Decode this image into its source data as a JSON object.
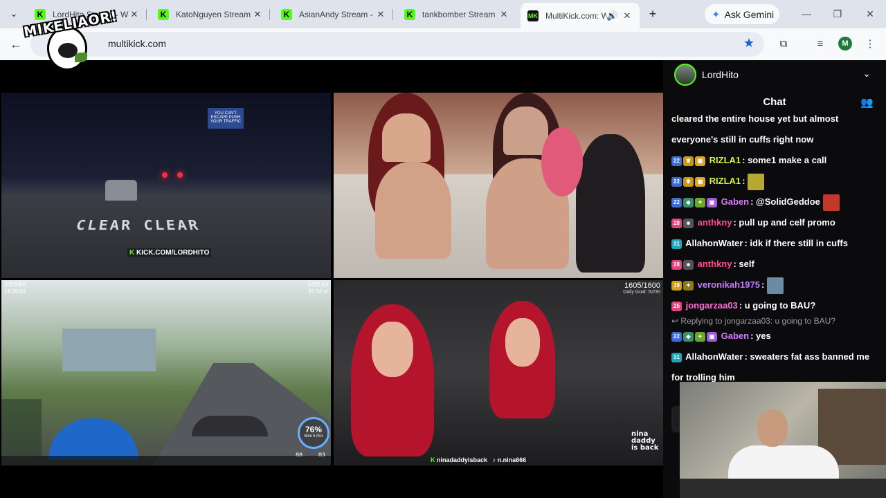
{
  "tabs": [
    {
      "title": "LordHito Stream - W",
      "favicon": "kick-icon",
      "active": false
    },
    {
      "title": "KatoNguyen Stream",
      "favicon": "kick-icon",
      "active": false
    },
    {
      "title": "AsianAndy Stream -",
      "favicon": "kick-icon",
      "active": false
    },
    {
      "title": "tankbomber Stream",
      "favicon": "kick-icon",
      "active": false
    },
    {
      "title": "MultiKick.com: W",
      "favicon": "multikick-icon",
      "active": true
    }
  ],
  "new_tab_label": "+",
  "gemini_label": "Ask Gemini",
  "address": {
    "url": "multikick.com"
  },
  "profile_initial": "M",
  "watermark": {
    "text": "MIKELIAOR!"
  },
  "streams": {
    "s1": {
      "road_text": "CLEAR CLEAR",
      "tag": "KICK.COM/LORDHITO",
      "billboard": "YOU CAN'T ESCAPE PUSH YOUR TRAFFIC"
    },
    "s3": {
      "date": "2026/8/6",
      "time": "19:30:02",
      "speed_top": "5425 kB",
      "speed_bottom": "37.34 m",
      "battery": "76%",
      "battery_sub": "Mini 5 Pro",
      "stat_a": "88",
      "stat_b": "83"
    },
    "s4": {
      "goal": "1605/1600",
      "goal_sub": "Daily Goal: 52/30",
      "handle_kick": "ninadaddyisback",
      "handle_tiktok": "n.nina666",
      "brand": "nina daddy is back"
    }
  },
  "chat": {
    "streamer": "LordHito",
    "title": "Chat",
    "messages": [
      {
        "user": "",
        "text": "cleared the entire house yet but almost",
        "badges": []
      },
      {
        "user": "",
        "text": "everyone's still in cuffs right now",
        "badges": []
      },
      {
        "user": "RIZLA1",
        "user_color": "#d4f53a",
        "text": "some1 make a call",
        "badges": [
          "22",
          "crown",
          "gift"
        ]
      },
      {
        "user": "RIZLA1",
        "user_color": "#d4f53a",
        "text": "",
        "emote": "#b8a830",
        "badges": [
          "22",
          "crown",
          "gift"
        ]
      },
      {
        "user": "Gaben",
        "user_color": "#d97bff",
        "text": "@SolidGeddoe",
        "emote": "#c0392b",
        "badges": [
          "22",
          "helm",
          "star",
          "gift"
        ]
      },
      {
        "user": "anthkny",
        "user_color": "#ff4f8b",
        "text": "pull up and celf promo",
        "badges": [
          "28",
          "face"
        ]
      },
      {
        "user": "AllahonWater",
        "user_color": "#ffffff",
        "text": "idk if there still in cuffs",
        "badges": [
          "31"
        ]
      },
      {
        "user": "anthkny",
        "user_color": "#ff4f8b",
        "text": "self",
        "badges": [
          "28",
          "face"
        ]
      },
      {
        "user": "veronikah1975",
        "user_color": "#c67bff",
        "text": "",
        "emote": "#6b8aa3",
        "badges": [
          "19",
          "star"
        ]
      },
      {
        "user": "jongarzaa03",
        "user_color": "#ff6ad5",
        "text": "u going to BAU?",
        "badges": [
          "25"
        ]
      },
      {
        "user": "Gaben",
        "user_color": "#d97bff",
        "text": "yes",
        "badges": [
          "22",
          "helm",
          "star",
          "gift"
        ]
      },
      {
        "user": "AllahonWater",
        "user_color": "#ffffff",
        "text": "sweaters fat ass banned me",
        "badges": [
          "31"
        ]
      },
      {
        "user": "",
        "text": "for trolling him",
        "badges": []
      }
    ],
    "reply": {
      "prefix": "Replying to",
      "user": "jongarzaa03",
      "text": "u going to BAU?"
    }
  }
}
